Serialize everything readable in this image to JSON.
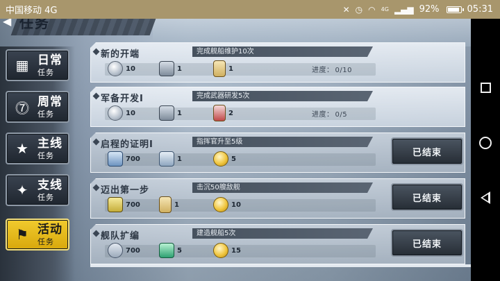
{
  "status_bar": {
    "carrier": "中国移动 4G",
    "network_badge": "4G",
    "battery": "92%",
    "time": "05:31",
    "icons": [
      "mute-icon",
      "alarm-icon",
      "wifi-icon",
      "signal-icon",
      "battery-icon"
    ]
  },
  "header": {
    "back_icon": "back-arrow-icon",
    "title": "任务"
  },
  "tabs": [
    {
      "id": "daily",
      "main": "日常",
      "sub": "任务",
      "icon": "calendar-icon",
      "active": false
    },
    {
      "id": "weekly",
      "main": "周常",
      "sub": "任务",
      "icon": "calendar-7-icon",
      "active": false
    },
    {
      "id": "main",
      "main": "主线",
      "sub": "任务",
      "icon": "star-icon",
      "active": false
    },
    {
      "id": "side",
      "main": "支线",
      "sub": "任务",
      "icon": "stars-icon",
      "active": false
    },
    {
      "id": "event",
      "main": "活动",
      "sub": "任务",
      "icon": "flag-icon",
      "active": true
    }
  ],
  "missions": [
    {
      "name": "新的开端",
      "desc": "完成舰船维护10次",
      "rewards": [
        {
          "icon": "coin-icon",
          "amount": "10"
        },
        {
          "icon": "supply-crate-icon",
          "amount": "1"
        },
        {
          "icon": "ticket-icon",
          "amount": "1"
        }
      ],
      "progress_label": "进度：",
      "progress_value": "0/10",
      "status": ""
    },
    {
      "name": "军备开发I",
      "desc": "完成武器研发5次",
      "rewards": [
        {
          "icon": "coin-icon",
          "amount": "10"
        },
        {
          "icon": "supply-crate-icon",
          "amount": "1"
        },
        {
          "icon": "red-ticket-icon",
          "amount": "2"
        }
      ],
      "progress_label": "进度：",
      "progress_value": "0/5",
      "status": ""
    },
    {
      "name": "启程的证明I",
      "desc": "指挥官升至5级",
      "rewards": [
        {
          "icon": "manual-icon",
          "amount": "700"
        },
        {
          "icon": "cards-icon",
          "amount": "1"
        },
        {
          "icon": "gold-coin-icon",
          "amount": "5"
        }
      ],
      "progress_label": "",
      "progress_value": "",
      "status": "已结束"
    },
    {
      "name": "迈出第一步",
      "desc": "击沉50艘敌舰",
      "rewards": [
        {
          "icon": "oil-drum-icon",
          "amount": "700"
        },
        {
          "icon": "ticket-icon",
          "amount": "1"
        },
        {
          "icon": "gold-coin-icon",
          "amount": "10"
        }
      ],
      "progress_label": "",
      "progress_value": "",
      "status": "已结束"
    },
    {
      "name": "舰队扩编",
      "desc": "建造舰船5次",
      "rewards": [
        {
          "icon": "wrench-icon",
          "amount": "700"
        },
        {
          "icon": "bottle-icon",
          "amount": "5"
        },
        {
          "icon": "gold-coin-icon",
          "amount": "15"
        }
      ],
      "progress_label": "",
      "progress_value": "",
      "status": "已结束"
    }
  ],
  "nav": {
    "recent": "recent-apps-icon",
    "home": "home-icon",
    "back": "back-icon"
  }
}
